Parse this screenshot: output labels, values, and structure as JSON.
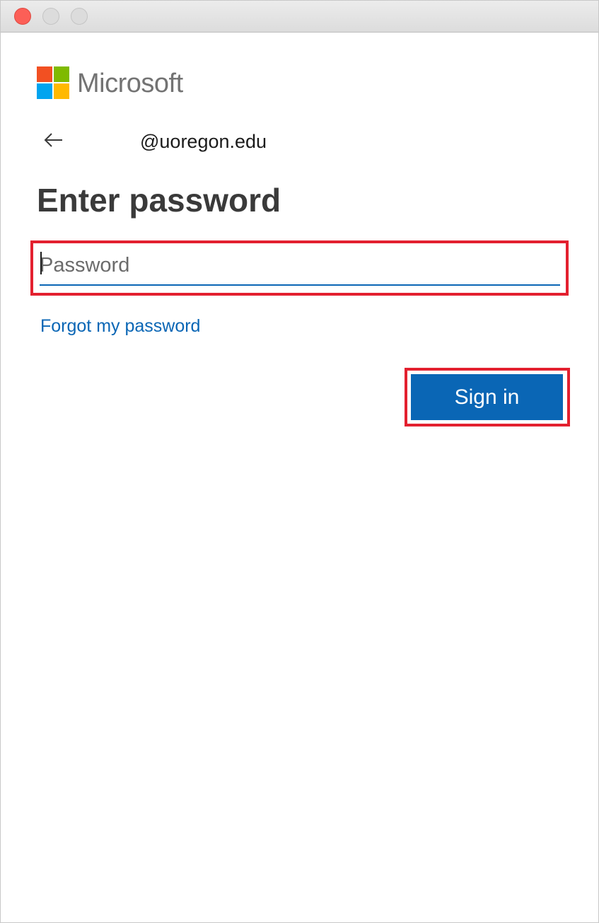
{
  "window": {
    "controls": [
      "close-button",
      "minimize-button",
      "zoom-button"
    ]
  },
  "brand": {
    "name": "Microsoft",
    "logo_colors": [
      "#f25022",
      "#7fba00",
      "#00a4ef",
      "#ffb900"
    ]
  },
  "account": {
    "back_icon": "arrow-left-icon",
    "identity": "@uoregon.edu"
  },
  "form": {
    "heading": "Enter password",
    "password_placeholder": "Password",
    "password_value": "",
    "forgot_link": "Forgot my password",
    "signin_label": "Sign in"
  },
  "colors": {
    "accent": "#0067b8",
    "highlight": "#e3202f"
  }
}
